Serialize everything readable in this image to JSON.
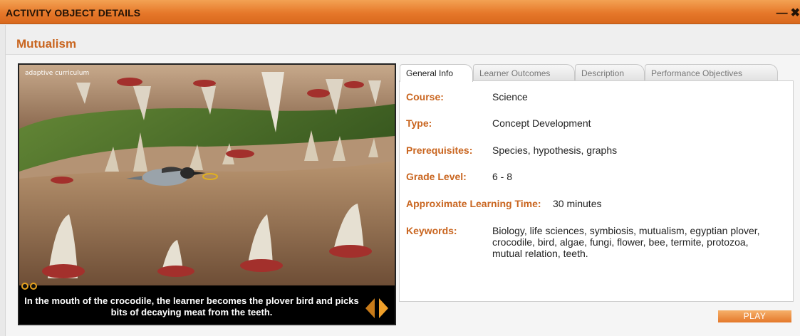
{
  "window": {
    "title": "ACTIVITY OBJECT DETAILS",
    "minimize_icon": "minimize-icon",
    "close_icon": "close-icon"
  },
  "activity": {
    "title": "Mutualism"
  },
  "video": {
    "logo_text": "adaptive curriculum",
    "caption": "In the mouth of the crocodile, the learner becomes the plover bird and picks bits of decaying meat from the teeth.",
    "prev_icon": "prev-arrow-icon",
    "next_icon": "next-arrow-icon"
  },
  "tabs": [
    {
      "label": "General Info",
      "active": true
    },
    {
      "label": "Learner Outcomes",
      "active": false
    },
    {
      "label": "Description",
      "active": false
    },
    {
      "label": "Performance Objectives",
      "active": false
    }
  ],
  "general_info": {
    "course": {
      "label": "Course:",
      "value": "Science"
    },
    "type": {
      "label": "Type:",
      "value": "Concept Development"
    },
    "prerequisites": {
      "label": "Prerequisites:",
      "value": "Species, hypothesis, graphs"
    },
    "grade_level": {
      "label": "Grade Level:",
      "value": "6 - 8"
    },
    "learning_time": {
      "label": "Approximate Learning Time:",
      "value": "30 minutes"
    },
    "keywords": {
      "label": "Keywords:",
      "value": "Biology, life sciences, symbiosis, mutualism, egyptian plover, crocodile, bird, algae, fungi, flower, bee, termite, protozoa, mutual relation, teeth."
    }
  },
  "play_button": {
    "label": "PLAY"
  },
  "colors": {
    "accent": "#c9651f",
    "titlebar": "#e6782a"
  }
}
